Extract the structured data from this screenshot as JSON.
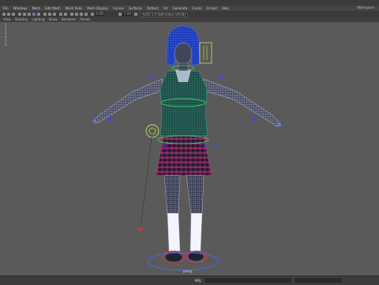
{
  "menubar": {
    "items": [
      "File",
      "Windows",
      "Mesh",
      "Edit Mesh",
      "Mesh Tools",
      "Mesh Display",
      "Curves",
      "Surfaces",
      "Deform",
      "UV",
      "Generate",
      "Cache",
      "Arnold",
      "Help"
    ],
    "workspace": "Workspace"
  },
  "panel_menu": [
    "View",
    "Shading",
    "Lighting",
    "Show",
    "Renderer",
    "Panels"
  ],
  "toolbar": {
    "field_a": "0.00",
    "field_b": "1.00",
    "camera": "ACES 1.0 SDR-video (sRGB)"
  },
  "left_tools": [
    "1",
    "2",
    "3",
    "4",
    "5",
    "6"
  ],
  "viewport": {
    "background_color": "#5a5a5a",
    "floor_label": "persp"
  },
  "status_bar": {
    "label": "MEL"
  }
}
